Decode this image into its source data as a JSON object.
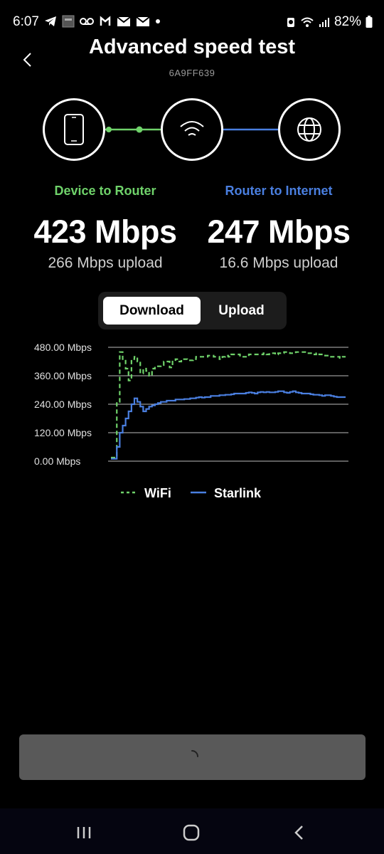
{
  "status_bar": {
    "time": "6:07",
    "battery": "82%",
    "icons_left": [
      "telegram-icon",
      "notification-thumbnail-icon",
      "voicemail-icon",
      "mi-icon",
      "gmail-icon",
      "mail-icon",
      "dot-icon"
    ],
    "icons_right": [
      "alarm-icon",
      "wifi-icon",
      "signal-icon",
      "battery-icon"
    ]
  },
  "header": {
    "title": "Advanced speed test",
    "device_id": "6A9FF639"
  },
  "topology": {
    "nodes": [
      "phone-icon",
      "wifi-router-icon",
      "globe-icon"
    ],
    "link_colors": {
      "device_router": "#6fd26a",
      "router_internet": "#4a7fe0"
    }
  },
  "results": {
    "device_to_router": {
      "label": "Device to Router",
      "download": "423 Mbps",
      "upload": "266 Mbps upload",
      "color": "#6fd26a"
    },
    "router_to_internet": {
      "label": "Router to Internet",
      "download": "247 Mbps",
      "upload": "16.6 Mbps upload",
      "color": "#4a7fe0"
    }
  },
  "toggle": {
    "options": [
      "Download",
      "Upload"
    ],
    "selected": "Download"
  },
  "chart_data": {
    "type": "line",
    "title": "",
    "xlabel": "",
    "ylabel": "",
    "ylim": [
      0,
      480
    ],
    "yticks": [
      "480.00 Mbps",
      "360.00 Mbps",
      "240.00 Mbps",
      "120.00 Mbps",
      "0.00 Mbps"
    ],
    "ytick_values": [
      480,
      360,
      240,
      120,
      0
    ],
    "grid": true,
    "legend": "bottom",
    "x": [
      0,
      1,
      2,
      3,
      4,
      5,
      6,
      7,
      8,
      9,
      10,
      11,
      12,
      13,
      14,
      15,
      16,
      17,
      18,
      19,
      20,
      21,
      22,
      23,
      24,
      25,
      26,
      27,
      28,
      29,
      30,
      31,
      32,
      33,
      34,
      35,
      36,
      37,
      38,
      39,
      40,
      41,
      42,
      43,
      44,
      45,
      46,
      47,
      48,
      49,
      50,
      51,
      52,
      53,
      54,
      55,
      56,
      57,
      58,
      59,
      60,
      61,
      62,
      63,
      64,
      65,
      66,
      67,
      68,
      69,
      70,
      71,
      72,
      73,
      74,
      75,
      76,
      77,
      78,
      79,
      80
    ],
    "series": [
      {
        "name": "WiFi",
        "style": "dashed",
        "color": "#6fd26a",
        "values": [
          15,
          15,
          250,
          460,
          430,
          390,
          340,
          430,
          440,
          420,
          370,
          390,
          380,
          360,
          390,
          400,
          400,
          405,
          420,
          420,
          395,
          420,
          430,
          420,
          430,
          430,
          425,
          425,
          430,
          440,
          440,
          440,
          440,
          445,
          445,
          440,
          440,
          430,
          440,
          445,
          440,
          450,
          450,
          450,
          440,
          440,
          440,
          450,
          450,
          450,
          450,
          450,
          455,
          450,
          455,
          455,
          450,
          455,
          455,
          460,
          460,
          455,
          455,
          460,
          460,
          460,
          460,
          455,
          455,
          450,
          455,
          450,
          450,
          445,
          445,
          440,
          440,
          440,
          435,
          440,
          440
        ]
      },
      {
        "name": "Starlink",
        "style": "solid",
        "color": "#4a7fe0",
        "values": [
          10,
          10,
          60,
          120,
          150,
          180,
          210,
          240,
          265,
          250,
          230,
          210,
          220,
          230,
          235,
          240,
          245,
          250,
          250,
          255,
          255,
          255,
          260,
          260,
          260,
          262,
          262,
          265,
          265,
          268,
          270,
          268,
          270,
          270,
          275,
          275,
          275,
          278,
          278,
          280,
          280,
          282,
          285,
          285,
          285,
          285,
          288,
          290,
          288,
          285,
          290,
          292,
          290,
          292,
          290,
          290,
          292,
          295,
          295,
          290,
          288,
          292,
          295,
          290,
          288,
          285,
          285,
          285,
          282,
          280,
          280,
          278,
          275,
          278,
          278,
          275,
          272,
          270,
          270,
          270,
          270
        ]
      }
    ]
  },
  "action_button": {
    "state": "loading",
    "icon": "spinner-icon"
  },
  "nav": [
    "recents-icon",
    "home-icon",
    "back-nav-icon"
  ]
}
